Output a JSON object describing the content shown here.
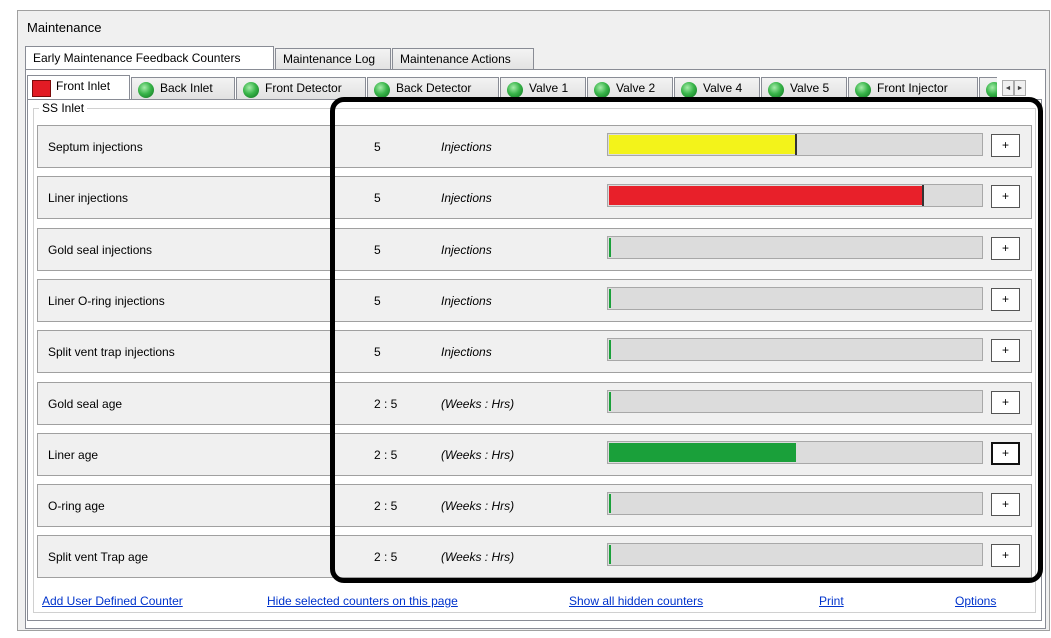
{
  "window": {
    "title": "Maintenance"
  },
  "main_tabs": [
    {
      "label": "Early Maintenance Feedback Counters",
      "active": true
    },
    {
      "label": "Maintenance Log",
      "active": false
    },
    {
      "label": "Maintenance Actions",
      "active": false
    }
  ],
  "sub_tabs": [
    {
      "label": "Front Inlet",
      "icon": "red-square-icon",
      "active": true
    },
    {
      "label": "Back Inlet",
      "icon": "green-ball-icon"
    },
    {
      "label": "Front Detector",
      "icon": "green-ball-icon"
    },
    {
      "label": "Back Detector",
      "icon": "green-ball-icon"
    },
    {
      "label": "Valve 1",
      "icon": "green-ball-icon"
    },
    {
      "label": "Valve 2",
      "icon": "green-ball-icon"
    },
    {
      "label": "Valve 4",
      "icon": "green-ball-icon"
    },
    {
      "label": "Valve 5",
      "icon": "green-ball-icon"
    },
    {
      "label": "Front Injector",
      "icon": "green-ball-icon"
    }
  ],
  "scroll": {
    "left": "◄",
    "right": "►"
  },
  "group": {
    "label": "SS Inlet"
  },
  "counters": [
    {
      "name": "Septum injections",
      "value": "5",
      "unit": "Injections",
      "level": 0.5,
      "color": "#f3f31a",
      "marker": true
    },
    {
      "name": "Liner injections",
      "value": "5",
      "unit": "Injections",
      "level": 0.84,
      "color": "#e8202a",
      "marker": true
    },
    {
      "name": "Gold seal injections",
      "value": "5",
      "unit": "Injections",
      "level": 0.0,
      "color": "#1aa03a"
    },
    {
      "name": "Liner O-ring injections",
      "value": "5",
      "unit": "Injections",
      "level": 0.0,
      "color": "#1aa03a"
    },
    {
      "name": "Split vent trap injections",
      "value": "5",
      "unit": "Injections",
      "level": 0.0,
      "color": "#1aa03a"
    },
    {
      "name": "Gold seal age",
      "value": "2 : 5",
      "unit": "(Weeks : Hrs)",
      "level": 0.0,
      "color": "#1aa03a"
    },
    {
      "name": "Liner age",
      "value": "2 : 5",
      "unit": "(Weeks : Hrs)",
      "level": 0.5,
      "color": "#1aa03a",
      "focused": true
    },
    {
      "name": "O-ring age",
      "value": "2 : 5",
      "unit": "(Weeks : Hrs)",
      "level": 0.0,
      "color": "#1aa03a"
    },
    {
      "name": "Split vent Trap age",
      "value": "2 : 5",
      "unit": "(Weeks : Hrs)",
      "level": 0.0,
      "color": "#1aa03a"
    }
  ],
  "plus_label": "+",
  "links": {
    "add": "Add User Defined Counter",
    "hide": "Hide selected counters on this page",
    "show": "Show all hidden counters",
    "print": "Print",
    "options": "Options"
  }
}
